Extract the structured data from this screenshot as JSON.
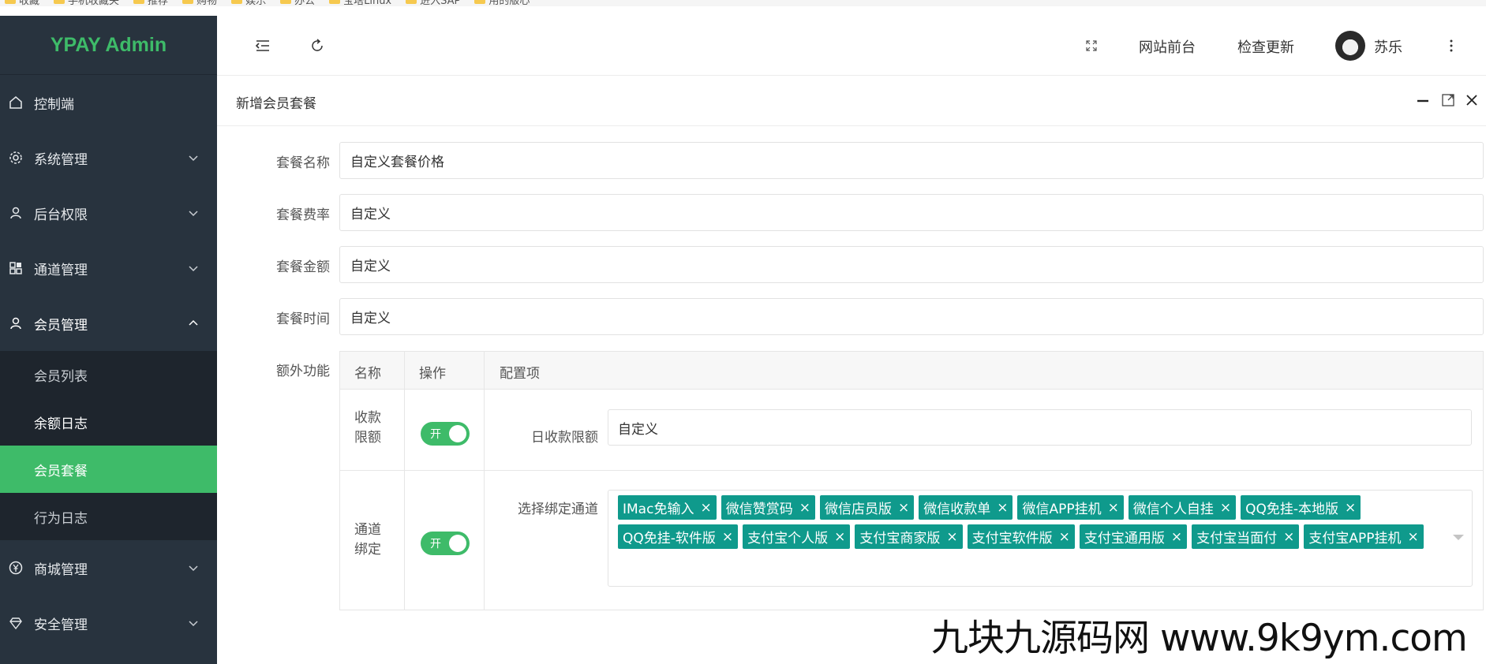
{
  "bookmarks": [
    "收藏",
    "手机收藏夹",
    "推荐",
    "购物",
    "娱乐",
    "办公",
    "宝塔Linux",
    "进入SAP",
    "用的版心"
  ],
  "sidebar": {
    "logo": "YPAY Admin",
    "items": [
      {
        "label": "控制端",
        "icon": "home-icon"
      },
      {
        "label": "系统管理",
        "icon": "gear-icon"
      },
      {
        "label": "后台权限",
        "icon": "user-icon"
      },
      {
        "label": "通道管理",
        "icon": "grid-icon"
      },
      {
        "label": "会员管理",
        "icon": "user-icon",
        "expanded": true
      },
      {
        "label": "商城管理",
        "icon": "yen-icon"
      },
      {
        "label": "安全管理",
        "icon": "diamond-icon"
      }
    ],
    "submenu": [
      {
        "label": "会员列表"
      },
      {
        "label": "余额日志"
      },
      {
        "label": "会员套餐",
        "active": true
      },
      {
        "label": "行为日志"
      }
    ]
  },
  "topbar": {
    "site_front": "网站前台",
    "check_update": "检查更新",
    "username": "苏乐"
  },
  "panel": {
    "title": "新增会员套餐"
  },
  "form": {
    "name_label": "套餐名称",
    "name_value": "自定义套餐价格",
    "rate_label": "套餐费率",
    "rate_value": "自定义",
    "amount_label": "套餐金额",
    "amount_value": "自定义",
    "time_label": "套餐时间",
    "time_value": "自定义",
    "extra_label": "额外功能"
  },
  "extra_table": {
    "headers": [
      "名称",
      "操作",
      "配置项"
    ],
    "rows": [
      {
        "name": "收款限额",
        "switch_text": "开",
        "switch_on": true,
        "config_label": "日收款限额",
        "config_value": "自定义"
      },
      {
        "name": "通道绑定",
        "switch_text": "开",
        "switch_on": true,
        "config_label": "选择绑定通道",
        "tags": [
          "IMac免输入",
          "微信赞赏码",
          "微信店员版",
          "微信收款单",
          "微信APP挂机",
          "微信个人自挂",
          "QQ免挂-本地版",
          "QQ免挂-软件版",
          "支付宝个人版",
          "支付宝商家版",
          "支付宝软件版",
          "支付宝通用版",
          "支付宝当面付",
          "支付宝APP挂机"
        ]
      }
    ]
  },
  "watermark": "九块九源码网 www.9k9ym.com",
  "colors": {
    "sidebar_bg": "#28333e",
    "accent": "#3ebb69",
    "tag_bg": "#0f9a8c"
  }
}
